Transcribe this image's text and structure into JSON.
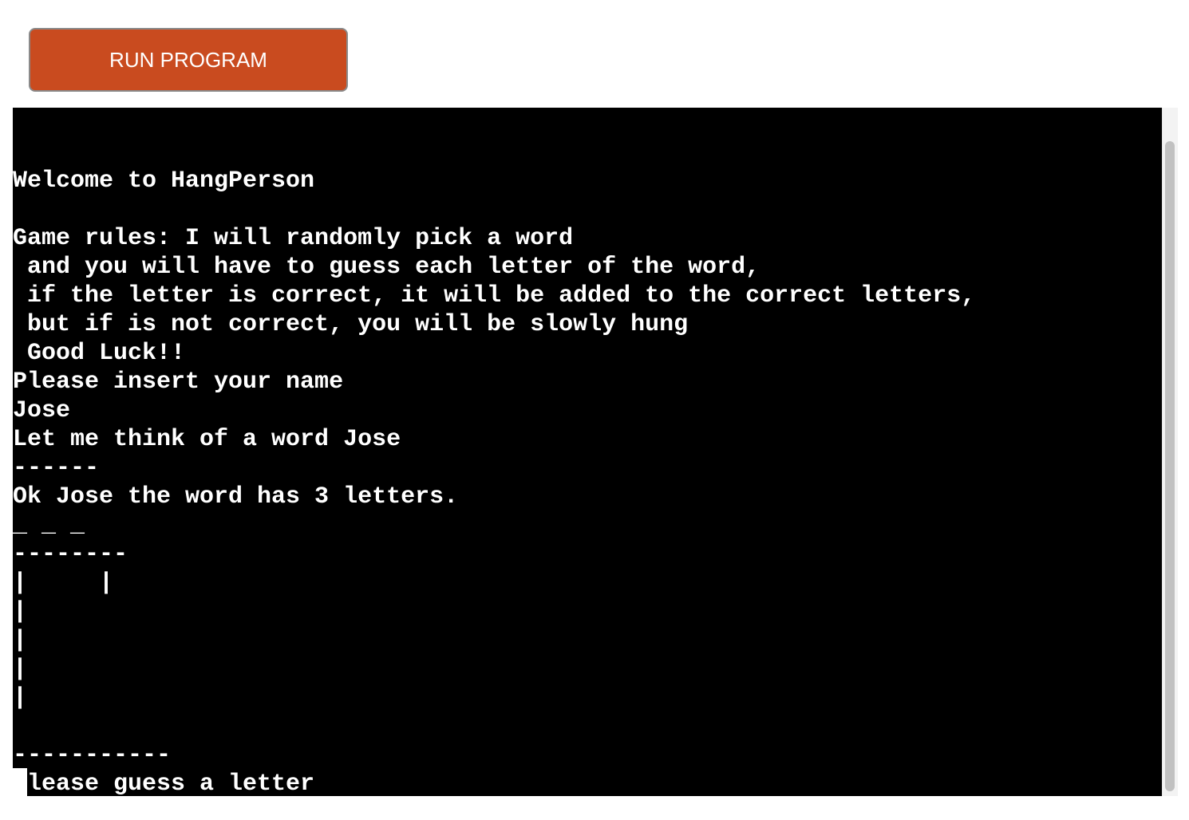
{
  "toolbar": {
    "run_label": "RUN PROGRAM"
  },
  "terminal": {
    "lines": [
      "Welcome to HangPerson",
      "",
      "Game rules: I will randomly pick a word",
      " and you will have to guess each letter of the word,",
      " if the letter is correct, it will be added to the correct letters,",
      " but if is not correct, you will be slowly hung",
      " Good Luck!!",
      "Please insert your name",
      "Jose",
      "Let me think of a word Jose",
      "------",
      "Ok Jose the word has 3 letters.",
      "_ _ _",
      "--------",
      "|     |",
      "|",
      "|",
      "|",
      "|",
      "",
      "-----------",
      "Please guess a letter"
    ]
  },
  "colors": {
    "button_bg": "#c94b1f",
    "terminal_bg": "#000000",
    "terminal_fg": "#ffffff"
  }
}
